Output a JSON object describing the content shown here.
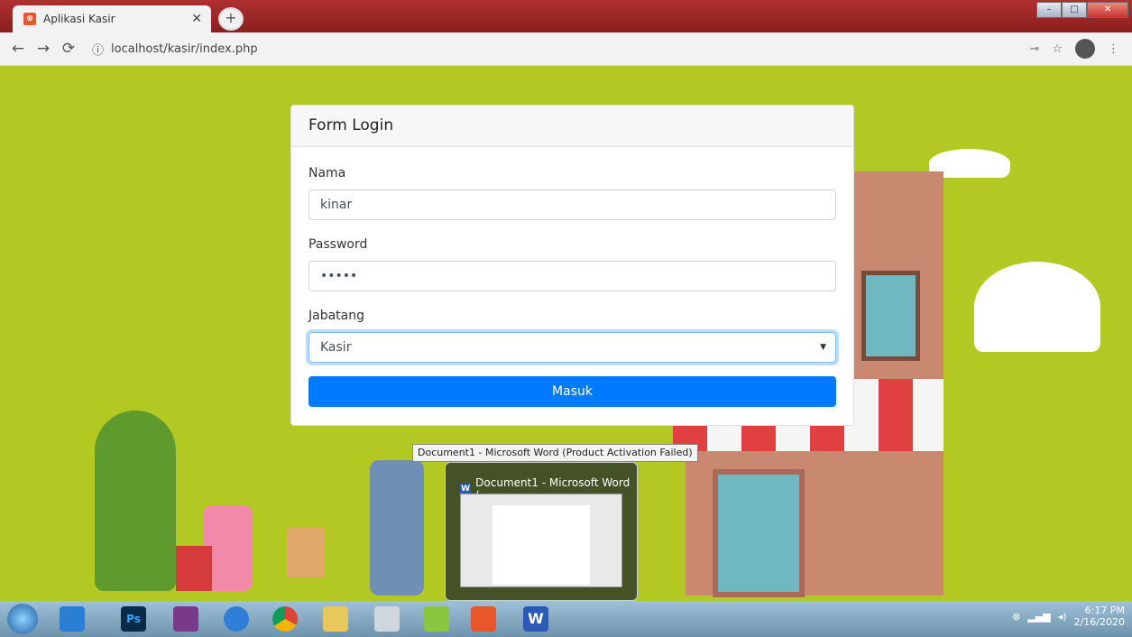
{
  "browser": {
    "tab_title": "Aplikasi Kasir",
    "url": "localhost/kasir/index.php"
  },
  "login": {
    "title": "Form Login",
    "name_label": "Nama",
    "name_value": "kinar",
    "password_label": "Password",
    "password_value": "•••••",
    "role_label": "Jabatang",
    "role_value": "Kasir",
    "submit_label": "Masuk"
  },
  "taskbar": {
    "tooltip": "Document1 - Microsoft Word (Product Activation Failed)",
    "thumb_title": "Document1 - Microsoft Word (...",
    "time": "6:17 PM",
    "date": "2/16/2020"
  },
  "colors": {
    "page_bg": "#b3c823",
    "primary": "#007bff",
    "titlebar": "#9b2525"
  },
  "icons": [
    "xampp-icon",
    "back-icon",
    "forward-icon",
    "reload-icon",
    "info-icon",
    "key-icon",
    "star-icon",
    "start-icon",
    "word-icon"
  ]
}
